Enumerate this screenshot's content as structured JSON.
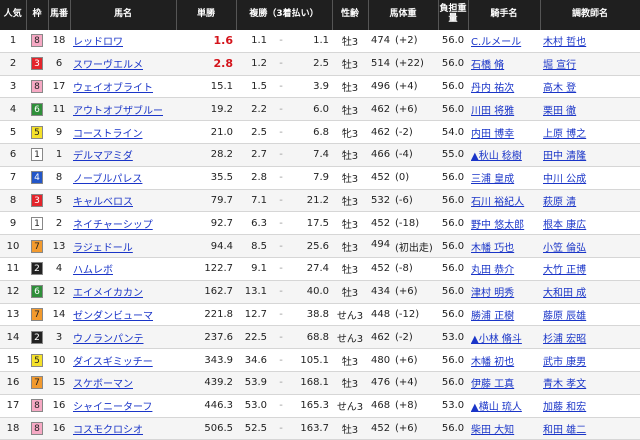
{
  "headers": {
    "ninki": "人気",
    "waku": "枠",
    "umaban": "馬番",
    "bamei": "馬名",
    "tansho": "単勝",
    "fukusho": "複勝（3着払い）",
    "seirei": "性齢",
    "bataiju": "馬体重",
    "kinryo": "負担重量",
    "kishu": "騎手名",
    "chokyoshi": "調教師名"
  },
  "waku_colors": {
    "1": {
      "bg": "#ffffff",
      "fg": "#222222"
    },
    "2": {
      "bg": "#222222",
      "fg": "#ffffff"
    },
    "3": {
      "bg": "#e3242b",
      "fg": "#ffffff"
    },
    "4": {
      "bg": "#2356c8",
      "fg": "#ffffff"
    },
    "5": {
      "bg": "#f5e12a",
      "fg": "#222222"
    },
    "6": {
      "bg": "#2f8f3a",
      "fg": "#ffffff"
    },
    "7": {
      "bg": "#f29a2e",
      "fg": "#222222"
    },
    "8": {
      "bg": "#f6a9c4",
      "fg": "#222222"
    }
  },
  "rows": [
    {
      "ninki": "1",
      "waku": "8",
      "umaban": "18",
      "bamei": "レッドロワ",
      "tansho": "1.6",
      "fuku_lo": "1.1",
      "fuku_hi": "1.1",
      "seirei": "牡3",
      "bw": "474",
      "bwd": "(+2)",
      "kinryo": "56.0",
      "kishu": "C.ルメール",
      "chokyoshi": "木村 哲也",
      "hi": true
    },
    {
      "ninki": "2",
      "waku": "3",
      "umaban": "6",
      "bamei": "スワーヴエルメ",
      "tansho": "2.8",
      "fuku_lo": "1.2",
      "fuku_hi": "2.5",
      "seirei": "牡3",
      "bw": "514",
      "bwd": "(+22)",
      "kinryo": "56.0",
      "kishu": "石橋 脩",
      "chokyoshi": "堀 宣行",
      "hi": true
    },
    {
      "ninki": "3",
      "waku": "8",
      "umaban": "17",
      "bamei": "ウェイオブライト",
      "tansho": "15.1",
      "fuku_lo": "1.5",
      "fuku_hi": "3.9",
      "seirei": "牡3",
      "bw": "496",
      "bwd": "(+4)",
      "kinryo": "56.0",
      "kishu": "丹内 祐次",
      "chokyoshi": "高木 登",
      "hi": false
    },
    {
      "ninki": "4",
      "waku": "6",
      "umaban": "11",
      "bamei": "アウトオブザブルー",
      "tansho": "19.2",
      "fuku_lo": "2.2",
      "fuku_hi": "6.0",
      "seirei": "牡3",
      "bw": "462",
      "bwd": "(+6)",
      "kinryo": "56.0",
      "kishu": "川田 将雅",
      "chokyoshi": "栗田 徹",
      "hi": false
    },
    {
      "ninki": "5",
      "waku": "5",
      "umaban": "9",
      "bamei": "コーストライン",
      "tansho": "21.0",
      "fuku_lo": "2.5",
      "fuku_hi": "6.8",
      "seirei": "牝3",
      "bw": "462",
      "bwd": "(-2)",
      "kinryo": "54.0",
      "kishu": "内田 博幸",
      "chokyoshi": "上原 博之",
      "hi": false
    },
    {
      "ninki": "6",
      "waku": "1",
      "umaban": "1",
      "bamei": "デルマアミダ",
      "tansho": "28.2",
      "fuku_lo": "2.7",
      "fuku_hi": "7.4",
      "seirei": "牡3",
      "bw": "466",
      "bwd": "(-4)",
      "kinryo": "55.0",
      "kishu": "▲秋山 稔樹",
      "chokyoshi": "田中 清隆",
      "hi": false
    },
    {
      "ninki": "7",
      "waku": "4",
      "umaban": "8",
      "bamei": "ノーブルパレス",
      "tansho": "35.5",
      "fuku_lo": "2.8",
      "fuku_hi": "7.9",
      "seirei": "牡3",
      "bw": "452",
      "bwd": "(0)",
      "kinryo": "56.0",
      "kishu": "三浦 皇成",
      "chokyoshi": "中川 公成",
      "hi": false
    },
    {
      "ninki": "8",
      "waku": "3",
      "umaban": "5",
      "bamei": "キャルベロス",
      "tansho": "79.7",
      "fuku_lo": "7.1",
      "fuku_hi": "21.2",
      "seirei": "牡3",
      "bw": "532",
      "bwd": "(-6)",
      "kinryo": "56.0",
      "kishu": "石川 裕紀人",
      "chokyoshi": "萩原 清",
      "hi": false
    },
    {
      "ninki": "9",
      "waku": "1",
      "umaban": "2",
      "bamei": "ネイチャーシップ",
      "tansho": "92.7",
      "fuku_lo": "6.3",
      "fuku_hi": "17.5",
      "seirei": "牡3",
      "bw": "452",
      "bwd": "(-18)",
      "kinryo": "56.0",
      "kishu": "野中 悠太郎",
      "chokyoshi": "根本 康広",
      "hi": false
    },
    {
      "ninki": "10",
      "waku": "7",
      "umaban": "13",
      "bamei": "ラジェドール",
      "tansho": "94.4",
      "fuku_lo": "8.5",
      "fuku_hi": "25.6",
      "seirei": "牡3",
      "bw": "494",
      "bwd": "(初出走)",
      "kinryo": "56.0",
      "kishu": "木幡 巧也",
      "chokyoshi": "小笠 倫弘",
      "hi": false
    },
    {
      "ninki": "11",
      "waku": "2",
      "umaban": "4",
      "bamei": "ハムレボ",
      "tansho": "122.7",
      "fuku_lo": "9.1",
      "fuku_hi": "27.4",
      "seirei": "牡3",
      "bw": "452",
      "bwd": "(-8)",
      "kinryo": "56.0",
      "kishu": "丸田 恭介",
      "chokyoshi": "大竹 正博",
      "hi": false
    },
    {
      "ninki": "12",
      "waku": "6",
      "umaban": "12",
      "bamei": "エイメイカカン",
      "tansho": "162.7",
      "fuku_lo": "13.1",
      "fuku_hi": "40.0",
      "seirei": "牡3",
      "bw": "434",
      "bwd": "(+6)",
      "kinryo": "56.0",
      "kishu": "津村 明秀",
      "chokyoshi": "大和田 成",
      "hi": false
    },
    {
      "ninki": "13",
      "waku": "7",
      "umaban": "14",
      "bamei": "ゼンダンビューマ",
      "tansho": "221.8",
      "fuku_lo": "12.7",
      "fuku_hi": "38.8",
      "seirei": "せん3",
      "bw": "448",
      "bwd": "(-12)",
      "kinryo": "56.0",
      "kishu": "勝浦 正樹",
      "chokyoshi": "藤原 辰雄",
      "hi": false
    },
    {
      "ninki": "14",
      "waku": "2",
      "umaban": "3",
      "bamei": "ウノランパンテ",
      "tansho": "237.6",
      "fuku_lo": "22.5",
      "fuku_hi": "68.8",
      "seirei": "せん3",
      "bw": "462",
      "bwd": "(-2)",
      "kinryo": "53.0",
      "kishu": "▲小林 脩斗",
      "chokyoshi": "杉浦 宏昭",
      "hi": false
    },
    {
      "ninki": "15",
      "waku": "5",
      "umaban": "10",
      "bamei": "ダイスギミッチー",
      "tansho": "343.9",
      "fuku_lo": "34.6",
      "fuku_hi": "105.1",
      "seirei": "牡3",
      "bw": "480",
      "bwd": "(+6)",
      "kinryo": "56.0",
      "kishu": "木幡 初也",
      "chokyoshi": "武市 康男",
      "hi": false
    },
    {
      "ninki": "16",
      "waku": "7",
      "umaban": "15",
      "bamei": "スケボーマン",
      "tansho": "439.2",
      "fuku_lo": "53.9",
      "fuku_hi": "168.1",
      "seirei": "牡3",
      "bw": "476",
      "bwd": "(+4)",
      "kinryo": "56.0",
      "kishu": "伊藤 工真",
      "chokyoshi": "青木 孝文",
      "hi": false
    },
    {
      "ninki": "17",
      "waku": "8",
      "umaban": "16",
      "bamei": "シャイニーターフ",
      "tansho": "446.3",
      "fuku_lo": "53.0",
      "fuku_hi": "165.3",
      "seirei": "せん3",
      "bw": "468",
      "bwd": "(+8)",
      "kinryo": "53.0",
      "kishu": "▲横山 琉人",
      "chokyoshi": "加藤 和宏",
      "hi": false
    },
    {
      "ninki": "18",
      "waku": "8",
      "umaban": "16",
      "bamei": "コスモクロシオ",
      "tansho": "506.5",
      "fuku_lo": "52.5",
      "fuku_hi": "163.7",
      "seirei": "牡3",
      "bw": "452",
      "bwd": "(+6)",
      "kinryo": "56.0",
      "kishu": "柴田 大知",
      "chokyoshi": "和田 雄二",
      "hi": false
    }
  ]
}
